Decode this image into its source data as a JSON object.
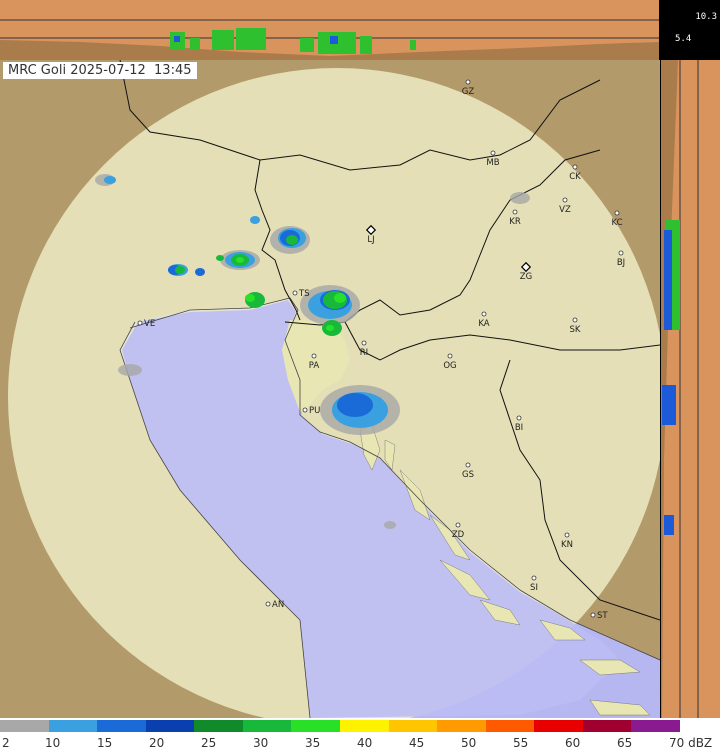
{
  "title": {
    "station": "MRC Goli",
    "date": "2025-07-12",
    "time": "13:45"
  },
  "height_labels": {
    "top": "10.3",
    "mid": "5.4"
  },
  "cities": [
    {
      "code": "GZ"
    },
    {
      "code": "MB"
    },
    {
      "code": "CK"
    },
    {
      "code": "VZ"
    },
    {
      "code": "KR"
    },
    {
      "code": "KC"
    },
    {
      "code": "LJ"
    },
    {
      "code": "ZG"
    },
    {
      "code": "BJ"
    },
    {
      "code": "TS"
    },
    {
      "code": "VE"
    },
    {
      "code": "KA"
    },
    {
      "code": "SK"
    },
    {
      "code": "RI"
    },
    {
      "code": "PA"
    },
    {
      "code": "OG"
    },
    {
      "code": "PU"
    },
    {
      "code": "BI"
    },
    {
      "code": "GS"
    },
    {
      "code": "ZD"
    },
    {
      "code": "KN"
    },
    {
      "code": "SI"
    },
    {
      "code": "AN"
    },
    {
      "code": "ST"
    }
  ],
  "legend": {
    "unit": "dBZ",
    "ticks": [
      "2",
      "10",
      "15",
      "20",
      "25",
      "30",
      "35",
      "40",
      "45",
      "50",
      "55",
      "60",
      "65",
      "70 dBZ"
    ],
    "colors": [
      "#a8a8a8",
      "#3aa0e0",
      "#1a6ad8",
      "#0a3fb0",
      "#108a2a",
      "#18b83a",
      "#28e028",
      "#fff200",
      "#ffc600",
      "#ff9a00",
      "#ff5a00",
      "#e80000",
      "#a00030",
      "#8a1a90"
    ]
  },
  "map_colors": {
    "sea": "#bcbcf4",
    "land": "#e8e7b4",
    "outside": "#b29a6a",
    "radar_disk": "#f4f4d6"
  }
}
